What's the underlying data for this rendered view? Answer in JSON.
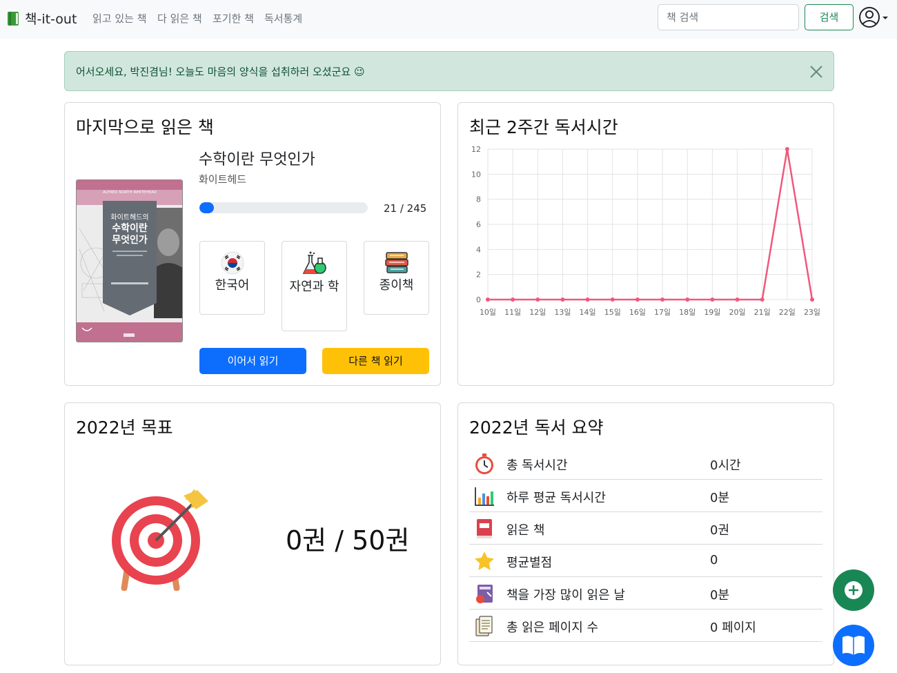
{
  "app": {
    "brand": "책-it-out",
    "nav": [
      "읽고 있는 책",
      "다 읽은 책",
      "포기한 책",
      "독서통계"
    ],
    "search_placeholder": "책 검색",
    "search_button": "검색"
  },
  "alert": {
    "message": "어서오세요, 박진겸님! 오늘도 마음의 양식을 섭취하러 오셨군요 😉"
  },
  "last_book": {
    "heading": "마지막으로 읽은 책",
    "title": "수학이란 무엇인가",
    "author": "화이트헤드",
    "progress_text": "21 / 245",
    "progress_fraction": 0.086,
    "cover_text": {
      "author_en": "ALFRED NORTH WHITEHEAD",
      "line1": "화이트헤드의",
      "line2": "수학이란",
      "line3": "무엇인가"
    },
    "language": "한국어",
    "category": "자연과 학",
    "format": "종이책",
    "continue_button": "이어서 읽기",
    "other_button": "다른 책 읽기"
  },
  "reading_time": {
    "heading": "최근 2주간 독서시간"
  },
  "chart_data": {
    "type": "line",
    "x": [
      "10일",
      "11일",
      "12일",
      "13일",
      "14일",
      "15일",
      "16일",
      "17일",
      "18일",
      "19일",
      "20일",
      "21일",
      "22일",
      "23일"
    ],
    "values": [
      0,
      0,
      0,
      0,
      0,
      0,
      0,
      0,
      0,
      0,
      0,
      0,
      12,
      0
    ],
    "ylim": [
      0,
      12
    ],
    "yticks": [
      "0",
      "2",
      "4",
      "6",
      "8",
      "10",
      "12"
    ],
    "color": "#f0587a",
    "grid": true
  },
  "goal": {
    "heading": "2022년 목표",
    "text": "0권 / 50권"
  },
  "summary": {
    "heading": "2022년 독서 요약",
    "rows": [
      {
        "icon": "stopwatch-icon",
        "label": "총 독서시간",
        "value": "0시간"
      },
      {
        "icon": "bar-chart-icon",
        "label": "하루 평균 독서시간",
        "value": "0분"
      },
      {
        "icon": "book-icon",
        "label": "읽은 책",
        "value": "0권"
      },
      {
        "icon": "star-icon",
        "label": "평균별점",
        "value": "0"
      },
      {
        "icon": "calendar-book-icon",
        "label": "책을 가장 많이 읽은 날",
        "value": "0분"
      },
      {
        "icon": "pages-icon",
        "label": "총 읽은 페이지 수",
        "value": "0 페이지"
      }
    ]
  },
  "colors": {
    "primary": "#0d6efd",
    "success": "#198754",
    "warning": "#ffc107",
    "alert_bg": "#d1e7dd",
    "chart_line": "#f0587a"
  }
}
